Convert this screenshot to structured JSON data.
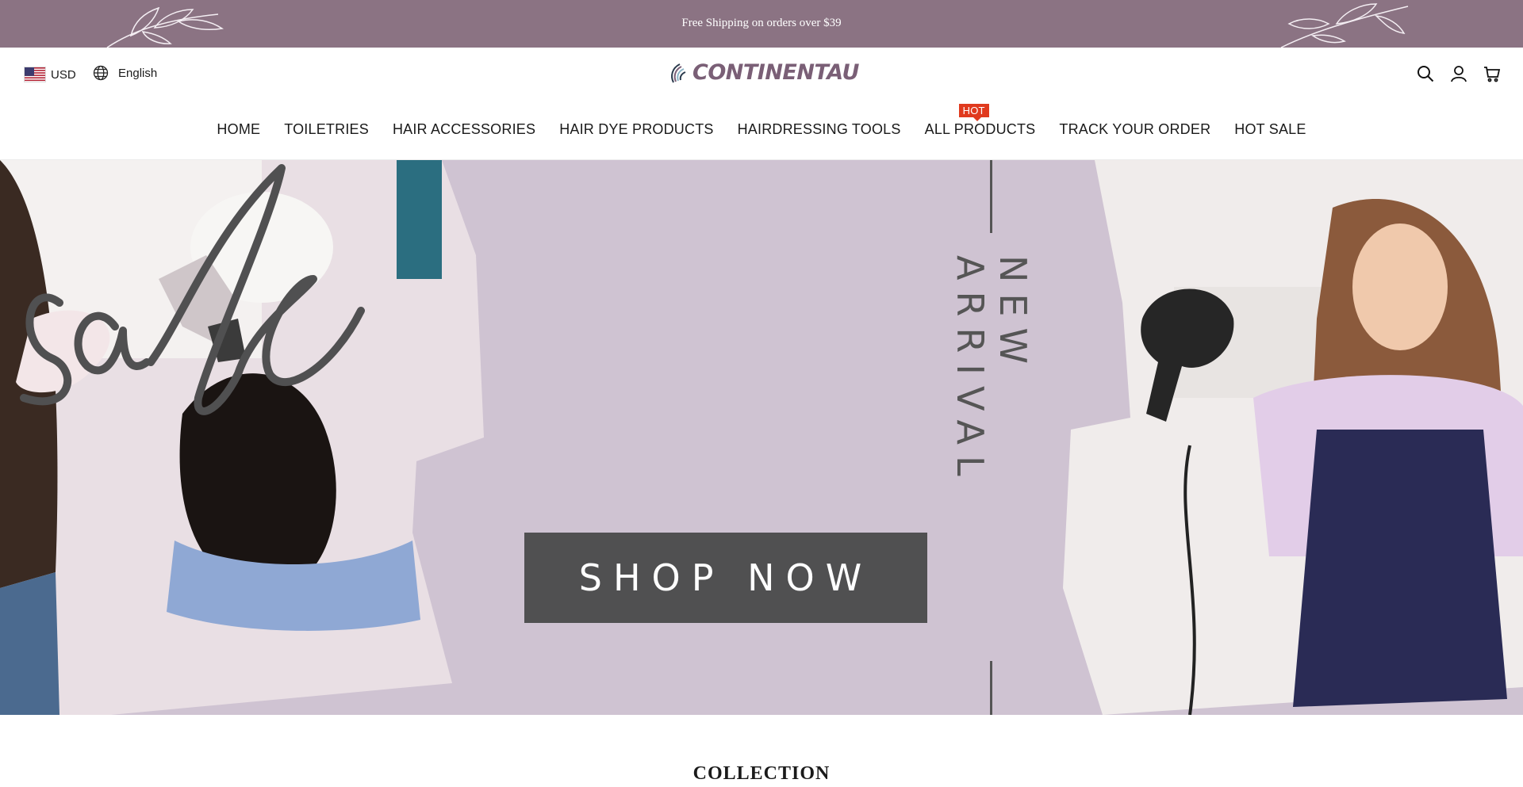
{
  "announcement": {
    "text": "Free Shipping on orders over $39"
  },
  "header": {
    "currency": "USD",
    "language": "English",
    "logo_text": "CONTINENTAU",
    "icons": [
      "search-icon",
      "account-icon",
      "cart-icon"
    ]
  },
  "nav": {
    "items": [
      {
        "label": "HOME"
      },
      {
        "label": "TOILETRIES"
      },
      {
        "label": "HAIR ACCESSORIES"
      },
      {
        "label": "HAIR DYE PRODUCTS"
      },
      {
        "label": "HAIRDRESSING TOOLS"
      },
      {
        "label": "ALL PRODUCTS",
        "badge": "HOT"
      },
      {
        "label": "TRACK YOUR ORDER"
      },
      {
        "label": "HOT SALE"
      }
    ]
  },
  "hero": {
    "script_text": "sale",
    "button_label": "SHOP NOW",
    "vertical_text": "NEW ARRIVAL"
  },
  "section": {
    "title": "COLLECTION"
  },
  "colors": {
    "announcement_bg": "#8b7383",
    "logo": "#7a5f76",
    "hero_bg": "#cfc3d2",
    "button_bg": "#505051",
    "hot_badge": "#e03a1e"
  }
}
